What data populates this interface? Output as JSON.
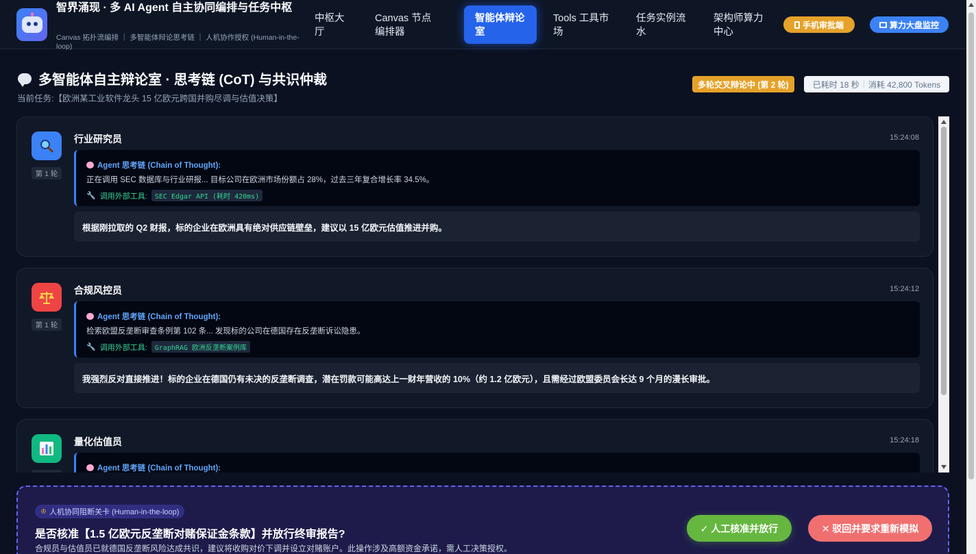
{
  "header": {
    "title": "智界涌现 · 多 AI Agent 自主协同编排与任务中枢",
    "subtitle": "Canvas 拓扑流编排 ｜ 多智能体辩论思考链 ｜ 人机协作授权 (Human-in-the-loop)",
    "nav": [
      {
        "label": "中枢大厅",
        "active": false
      },
      {
        "label": "Canvas 节点编排器",
        "active": false
      },
      {
        "label": "智能体辩论室",
        "active": true
      },
      {
        "label": "Tools 工具市场",
        "active": false
      },
      {
        "label": "任务实例流水",
        "active": false
      },
      {
        "label": "架构师算力中心",
        "active": false
      }
    ],
    "mobile_btn": "手机审批端",
    "monitor_btn": "算力大盘监控"
  },
  "page": {
    "title": "多智能体自主辩论室 · 思考链 (CoT) 与共识仲裁",
    "task": "当前任务:【欧洲某工业软件龙头 15 亿欧元跨国并购尽调与估值决策】",
    "status": "多轮交叉辩论中 (第 2 轮)",
    "elapsed": "已耗时 18 秒",
    "tokens": "消耗 42,800 Tokens"
  },
  "cot_label": "Agent 思考链 (Chain of Thought):",
  "tool_prefix": "调用外部工具:",
  "agents": [
    {
      "name": "行业研究员",
      "round": "第 1 轮",
      "time": "15:24:08",
      "icon": "magnifier-icon",
      "color": "#3b82f6",
      "thought": "正在调用 SEC 数据库与行业研报... 目标公司在欧洲市场份额占 28%，过去三年复合增长率 34.5%。",
      "tool": "SEC Edgar API (耗时 420ms)",
      "answer": "根据刚拉取的 Q2 财报，标的企业在欧洲具有绝对供应链壁垒，建议以 15 亿欧元估值推进并购。"
    },
    {
      "name": "合规风控员",
      "round": "第 1 轮",
      "time": "15:24:12",
      "icon": "scales-icon",
      "color": "#ef4444",
      "thought": "检索欧盟反垄断审查条例第 102 条... 发现标的公司在德国存在反垄断诉讼隐患。",
      "tool": "GraphRAG 欧洲反垄断案例库",
      "answer": "我强烈反对直接推进！标的企业在德国仍有未决的反垄断调查，潜在罚款可能高达上一财年营收的 10%（约 1.2 亿欧元），且需经过欧盟委员会长达 9 个月的漫长审批。"
    },
    {
      "name": "量化估值员",
      "round": "",
      "time": "15:24:18",
      "icon": "bar-chart-icon",
      "color": "#10b981",
      "thought": "",
      "tool": "",
      "answer": ""
    }
  ],
  "hitl": {
    "tag": "人机协同阻断关卡 (Human-in-the-loop)",
    "title": "是否核准【1.5 亿欧元反垄断对赌保证金条款】并放行终审报告?",
    "desc": "合规员与估值员已就德国反垄断风险达成共识，建议将收购对价下调并设立对赌账户。此操作涉及高额资金承诺，需人工决策授权。",
    "approve": "✓ 人工核准并放行",
    "reject": "✕ 驳回并要求重新模拟"
  }
}
